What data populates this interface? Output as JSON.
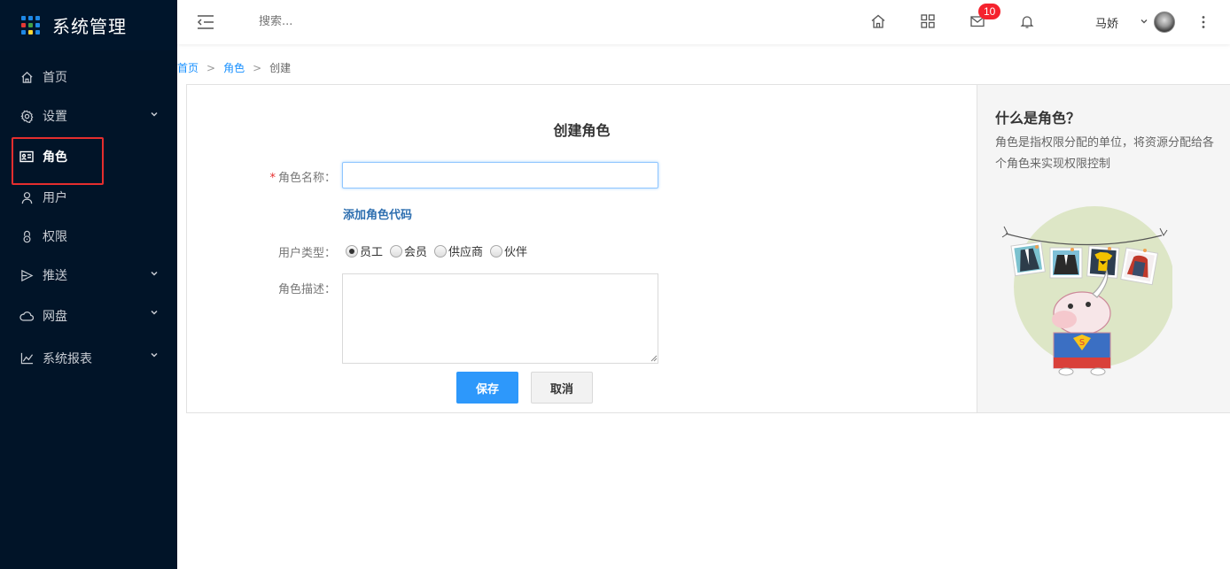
{
  "app": {
    "title": "系统管理"
  },
  "sidebar": {
    "items": [
      {
        "label": "首页",
        "icon": "home-icon"
      },
      {
        "label": "设置",
        "icon": "gear-icon",
        "has_children": true
      },
      {
        "label": "角色",
        "icon": "id-card-icon",
        "active": true
      },
      {
        "label": "用户",
        "icon": "user-icon"
      },
      {
        "label": "权限",
        "icon": "lock-icon"
      },
      {
        "label": "推送",
        "icon": "send-icon",
        "has_children": true
      },
      {
        "label": "网盘",
        "icon": "cloud-icon",
        "has_children": true
      },
      {
        "label": "系统报表",
        "icon": "line-chart-icon",
        "has_children": true
      }
    ]
  },
  "header": {
    "search_placeholder": "搜索...",
    "mail_badge": "10",
    "user_name": "马娇"
  },
  "breadcrumb": {
    "home": "首页",
    "role": "角色",
    "current": "创建",
    "separator": ">"
  },
  "form": {
    "title": "创建角色",
    "name_label": "角色名称：",
    "required_mark": "*",
    "name_value": "",
    "add_code_link": "添加角色代码",
    "user_type_label": "用户类型：",
    "user_types": [
      "员工",
      "会员",
      "供应商",
      "伙伴"
    ],
    "user_type_selected": "员工",
    "desc_label": "角色描述：",
    "desc_value": "",
    "save_label": "保存",
    "cancel_label": "取消"
  },
  "help": {
    "title": "什么是角色？",
    "text": "角色是指权限分配的单位，将资源分配给各个角色来实现权限控制"
  },
  "colors": {
    "sidebar_bg": "#011428",
    "primary": "#2d98fb",
    "highlight_border": "#e52e2e",
    "badge": "#f5222d"
  }
}
